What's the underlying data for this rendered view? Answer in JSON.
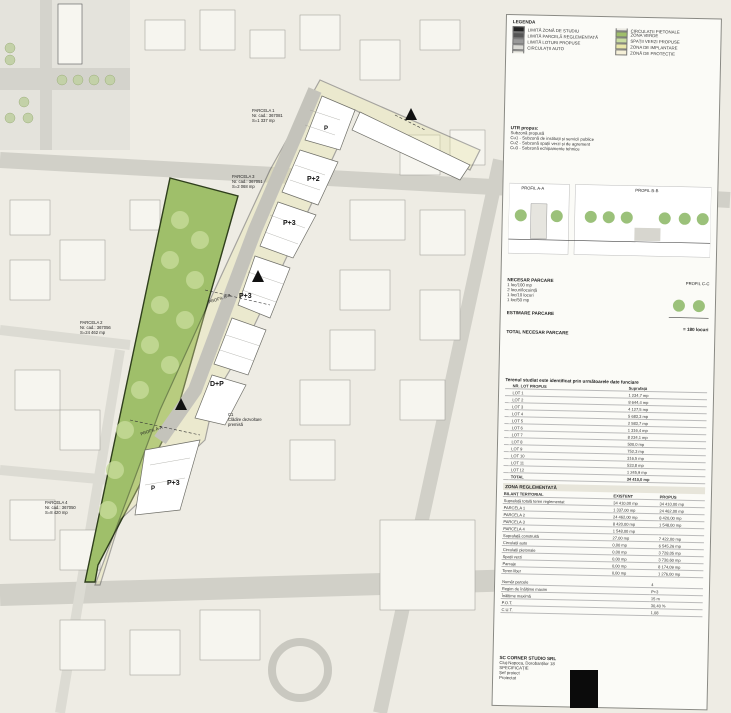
{
  "plan_labels": {
    "pp3_a": "P+3",
    "pp3_b": "P+3",
    "pp3_c": "P+3",
    "pp2": "P+2",
    "p_top": "P",
    "p_bottom": "P",
    "dp": "D+P",
    "profil_b": "PROFIL B-B",
    "profil_a": "PROFIL A-A",
    "parcela_1": [
      "PARCELA 1",
      "Nr. cad.: 367081",
      "S=1 337 mp"
    ],
    "parcela_2": [
      "PARCELA 2",
      "Nr. cad.: 367056",
      "S=24 462 mp"
    ],
    "parcela_3": [
      "PARCELA 3",
      "Nr. cad.: 367051",
      "S=2 068 mp"
    ],
    "parcela_4": [
      "PARCELA 4",
      "Nr. cad.: 367050",
      "S=8 420 mp"
    ],
    "cladire": [
      "C1",
      "Clădire dezvoltare",
      "premisă",
      "C2",
      "S.",
      "construită"
    ]
  },
  "legend": {
    "title": "LEGENDA",
    "items": [
      {
        "label": "LIMITĂ ZONĂ DE STUDIU",
        "color": "#222222"
      },
      {
        "label": "LIMITĂ PARCELĂ REGLEMENTATĂ",
        "color": "#555555"
      },
      {
        "label": "LIMITĂ LOTURI PROPUSE",
        "color": "#999999"
      },
      {
        "label": "CIRCULAȚII AUTO",
        "color": "#d9d9d4"
      },
      {
        "label": "CIRCULAȚII PIETONALE",
        "color": "#ecebe4"
      },
      {
        "label": "ZONA VERDE",
        "color": "#9fbf6a"
      },
      {
        "label": "SPAȚII VERZI PROPUSE",
        "color": "#c8dca0"
      },
      {
        "label": "ZONA DE IMPLANTARE",
        "color": "#e8e6a8"
      },
      {
        "label": "ZONĂ DE PROTECȚIE",
        "color": "#f5f0d8"
      }
    ]
  },
  "utr": {
    "title": "UTR propus:",
    "lines": [
      "Subzonă propusă",
      "Cu1 - Subzonă de instituții și servicii publice",
      "Cu2 - Subzonă spații verzi și de agrement",
      "Cu3 - Subzonă echipamente tehnice"
    ]
  },
  "profiles": {
    "a": "PROFIL A-A",
    "b": "PROFIL B-B",
    "c": "PROFIL C-C"
  },
  "parking": {
    "title": "NECESAR PARCARE",
    "lines": [
      "1 loc/100 mp",
      "2 locuri/locuință",
      "1 loc/10 locuri",
      "1 loc/50 mp"
    ],
    "estimate_title": "ESTIMARE PARCARE",
    "total_label": "TOTAL NECESAR PARCARE",
    "total_value": "= 180 locuri"
  },
  "lots": {
    "title": "Terenul studiat este identificat prin următoarele date funciare",
    "col_lot": "NR. LOT PROPUS",
    "col_area": "Suprafață",
    "rows": [
      {
        "lot": "LOT 1",
        "area": "1 234,7 mp"
      },
      {
        "lot": "LOT 2",
        "area": "8 644,4 mp"
      },
      {
        "lot": "LOT 3",
        "area": "4 127,5 mp"
      },
      {
        "lot": "LOT 4",
        "area": "5 683,3 mp"
      },
      {
        "lot": "LOT 5",
        "area": "2 583,7 mp"
      },
      {
        "lot": "LOT 6",
        "area": "1 316,4 mp"
      },
      {
        "lot": "LOT 7",
        "area": "8 234,1 mp"
      },
      {
        "lot": "LOT 8",
        "area": "500,0 mp"
      },
      {
        "lot": "LOT 9",
        "area": "752,3 mp"
      },
      {
        "lot": "LOT 10",
        "area": "316,5 mp"
      },
      {
        "lot": "LOT 11",
        "area": "533,8 mp"
      },
      {
        "lot": "LOT 12",
        "area": "1 245,9 mp"
      }
    ],
    "total_label": "TOTAL",
    "total_value": "34 410,0 mp"
  },
  "bilant": {
    "title": "ZONA REGLEMENTATĂ",
    "subtitle": "BILANȚ TERITORIAL",
    "col_existent": "EXISTENT",
    "col_propus": "PROPUS",
    "rows": [
      {
        "label": "Suprafață totală teren reglementat",
        "existent": "34 410,00 mp",
        "propus": "34 410,00 mp"
      },
      {
        "label": "PARCELA 1",
        "existent": "1 337,00 mp",
        "propus": "24 462,00 mp"
      },
      {
        "label": "PARCELA 2",
        "existent": "24 462,00 mp",
        "propus": "8 420,00 mp"
      },
      {
        "label": "PARCELA 3",
        "existent": "8 420,00 mp",
        "propus": "1 548,00 mp"
      },
      {
        "label": "PARCELA 4",
        "existent": "1 548,00 mp",
        "propus": ""
      },
      {
        "label": "Suprafață construită",
        "existent": "27,00 mp",
        "propus": "7 422,00 mp"
      },
      {
        "label": "Circulații auto",
        "existent": "0,00 mp",
        "propus": "6 545,26 mp"
      },
      {
        "label": "Circulații pietonale",
        "existent": "0,00 mp",
        "propus": "3 728,05 mp"
      },
      {
        "label": "Spații verzi",
        "existent": "0,00 mp",
        "propus": "3 730,60 mp"
      },
      {
        "label": "Parcaje",
        "existent": "0,00 mp",
        "propus": "8 174,09 mp"
      },
      {
        "label": "Teren liber",
        "existent": "0,00 mp",
        "propus": "1 276,00 mp"
      }
    ],
    "indices": [
      {
        "label": "Număr parcele",
        "value": "4"
      },
      {
        "label": "Regim de înălțime maxim",
        "value": "P+3"
      },
      {
        "label": "Înălțime maximă",
        "value": "15 m"
      },
      {
        "label": "P.O.T.",
        "value": "30,40 %"
      },
      {
        "label": "C.U.T.",
        "value": "1,08"
      }
    ]
  },
  "cartouche": {
    "company": "SC CORNER STUDIO SRL",
    "address": "Cluj-Napoca, Dorobanților 18",
    "rows": [
      "SPECIFICAȚIE",
      "Șef proiect",
      "Proiectat",
      "Desenat"
    ]
  }
}
